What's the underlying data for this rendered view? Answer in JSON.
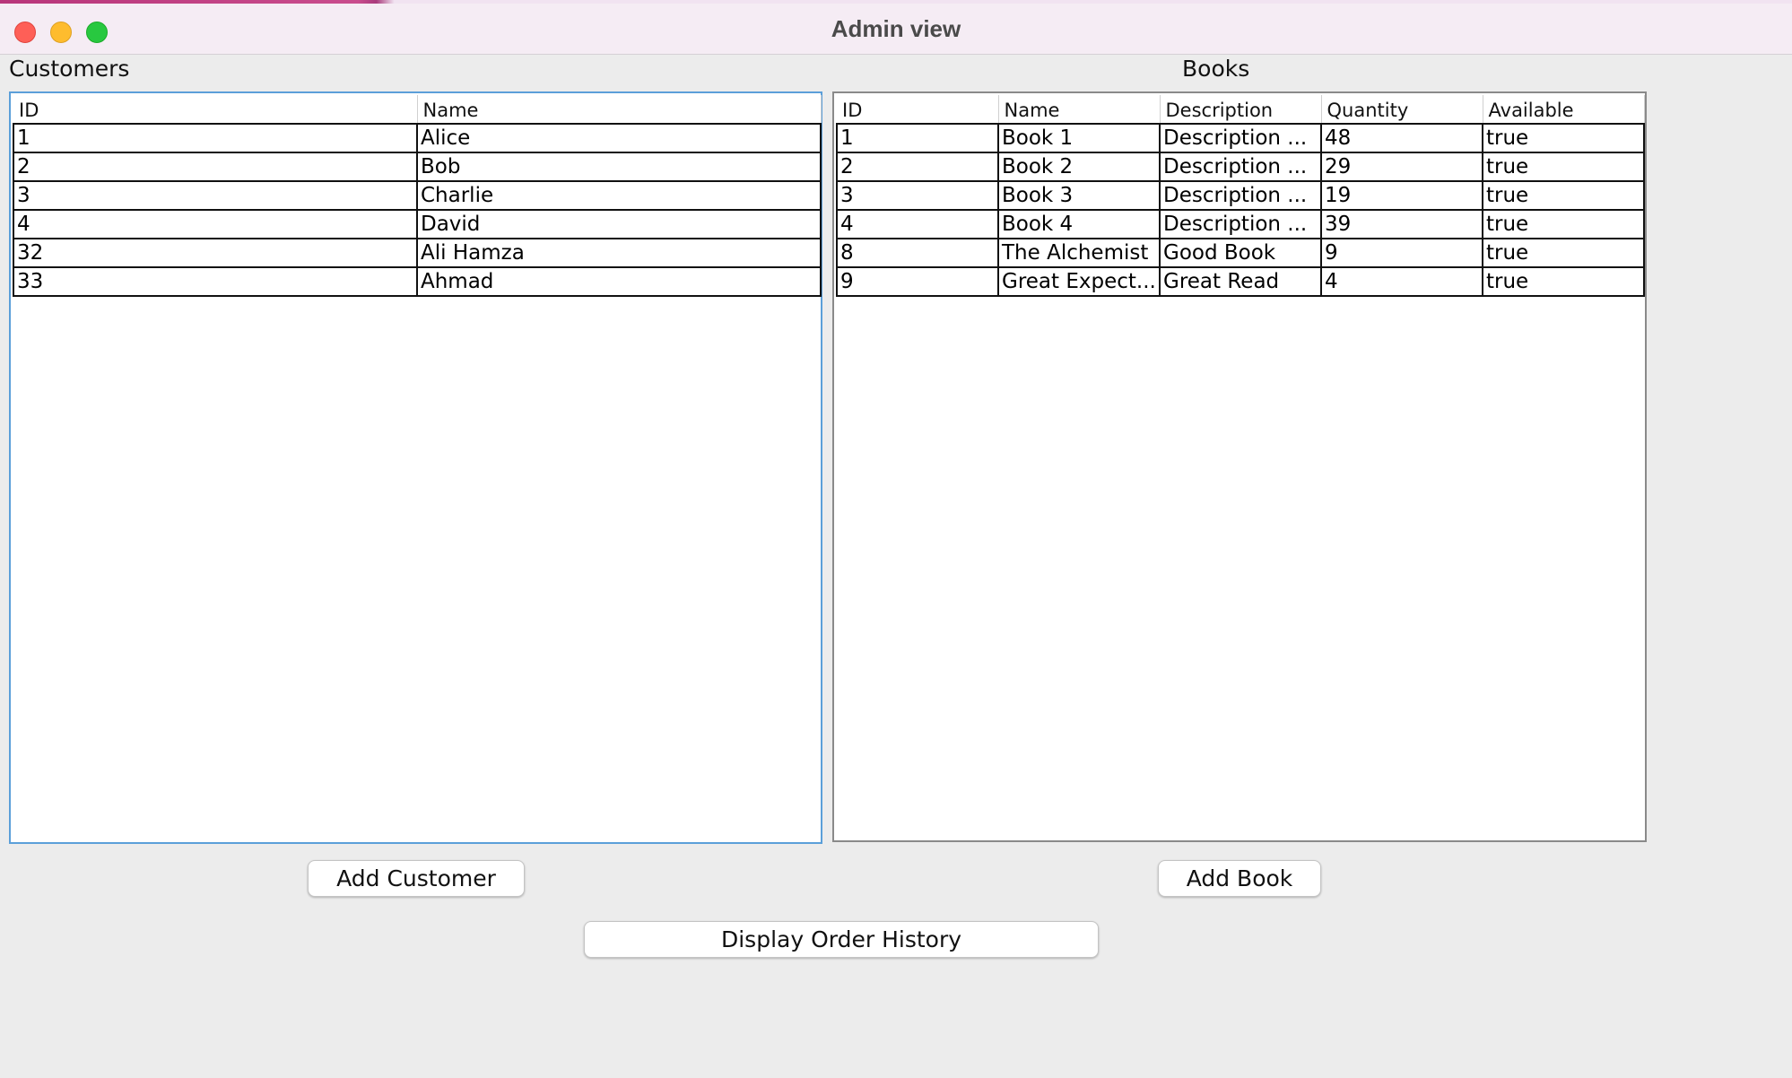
{
  "window": {
    "title": "Admin view"
  },
  "customers": {
    "label": "Customers",
    "columns": [
      "ID",
      "Name"
    ],
    "rows": [
      [
        "1",
        "Alice"
      ],
      [
        "2",
        "Bob"
      ],
      [
        "3",
        "Charlie"
      ],
      [
        "4",
        "David"
      ],
      [
        "32",
        "Ali Hamza"
      ],
      [
        "33",
        "Ahmad"
      ]
    ],
    "add_button": "Add Customer"
  },
  "books": {
    "label": "Books",
    "columns": [
      "ID",
      "Name",
      "Description",
      "Quantity",
      "Available"
    ],
    "rows": [
      [
        "1",
        "Book 1",
        "Description ...",
        "48",
        "true"
      ],
      [
        "2",
        "Book 2",
        "Description ...",
        "29",
        "true"
      ],
      [
        "3",
        "Book 3",
        "Description ...",
        "19",
        "true"
      ],
      [
        "4",
        "Book 4",
        "Description ...",
        "39",
        "true"
      ],
      [
        "8",
        "The Alchemist",
        "Good Book",
        "9",
        "true"
      ],
      [
        "9",
        "Great Expect...",
        "Great Read",
        "4",
        "true"
      ]
    ],
    "add_button": "Add Book"
  },
  "actions": {
    "order_history_button": "Display Order History"
  },
  "colors": {
    "close": "#fe5f57",
    "minimize": "#febc2e",
    "maximize": "#28c840",
    "focus_border": "#5b9fd9"
  }
}
